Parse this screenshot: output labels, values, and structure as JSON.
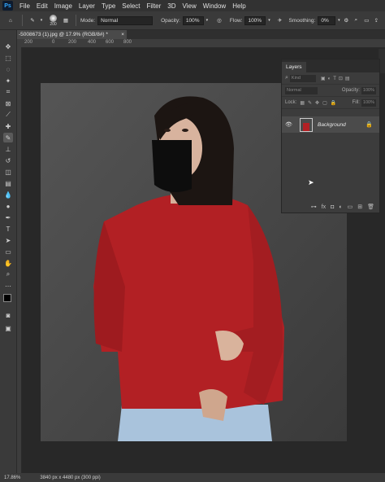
{
  "app": {
    "logo": "Ps"
  },
  "menu": [
    "File",
    "Edit",
    "Image",
    "Layer",
    "Type",
    "Select",
    "Filter",
    "3D",
    "View",
    "Window",
    "Help"
  ],
  "options": {
    "brush_size": "200",
    "mode_label": "Mode:",
    "mode_value": "Normal",
    "opacity_label": "Opacity:",
    "opacity_value": "100%",
    "flow_label": "Flow:",
    "flow_value": "100%",
    "smoothing_label": "Smoothing:",
    "smoothing_value": "0%",
    "angle_value": "0°"
  },
  "document": {
    "tab_title": "-5008673 (1).jpg @ 17.9% (RGB/8#) *"
  },
  "ruler": [
    "200",
    "0",
    "200",
    "400",
    "600",
    "800"
  ],
  "layers_panel": {
    "title": "Layers",
    "kind_label": "Kind",
    "blend_mode": "Normal",
    "opacity_label": "Opacity:",
    "opacity_value": "100%",
    "lock_label": "Lock:",
    "fill_label": "Fill:",
    "fill_value": "100%",
    "layer_name": "Background"
  },
  "status": {
    "zoom": "17.86%",
    "doc_info": "3840 px x 4480 px (300 ppi)"
  },
  "colors": {
    "accent": "#31a8ff",
    "sweater": "#b22024",
    "wall": "#4a4a4a"
  }
}
